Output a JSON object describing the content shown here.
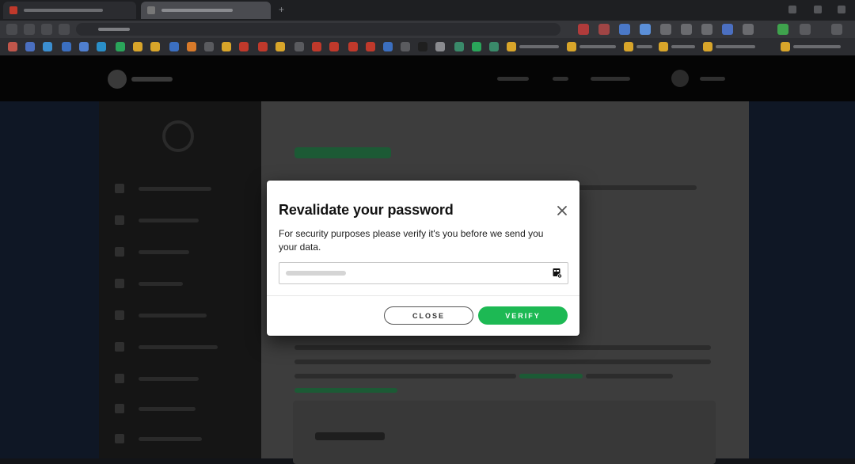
{
  "dialog": {
    "title": "Revalidate your password",
    "description": "For security purposes please verify it's you before we send you your data.",
    "password": {
      "value": "",
      "placeholder": ""
    },
    "close_label": "CLOSE",
    "verify_label": "VERIFY",
    "close_icon": "close-icon",
    "password_manager_icon": "key-icon"
  },
  "colors": {
    "accent": "#1db954",
    "dialog_bg": "#ffffff",
    "overlay": "#121418"
  }
}
